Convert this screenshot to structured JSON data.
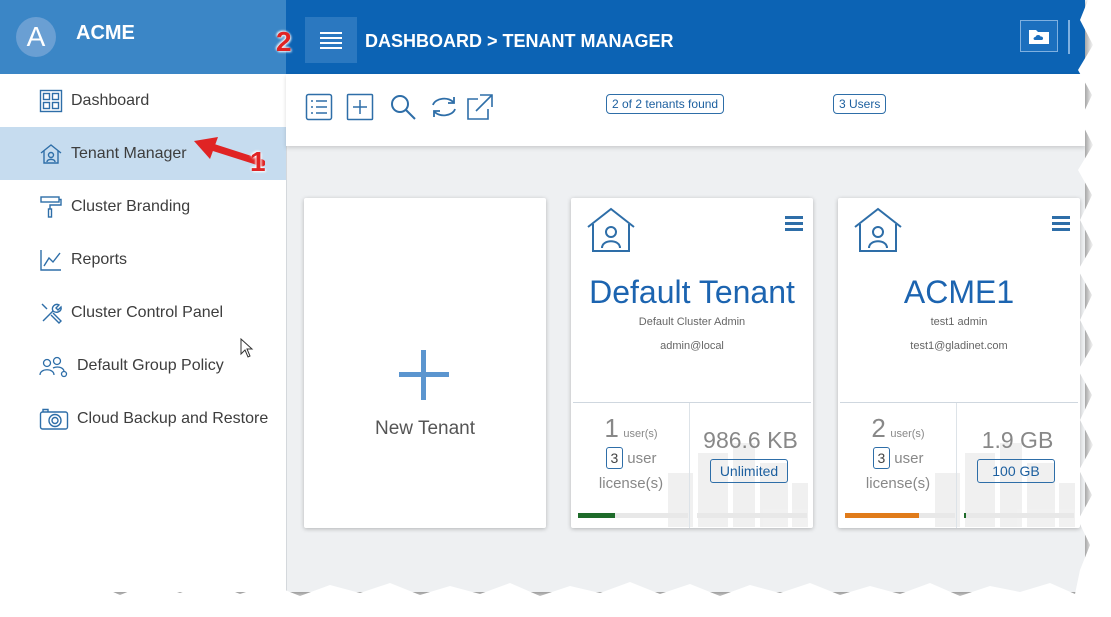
{
  "app": {
    "logo_letter": "A",
    "name": "ACME"
  },
  "header": {
    "breadcrumb": "DASHBOARD > TENANT MANAGER"
  },
  "sidebar": {
    "items": [
      {
        "label": "Dashboard",
        "icon": "dashboard-grid-icon",
        "active": false
      },
      {
        "label": "Tenant Manager",
        "icon": "tenant-house-icon",
        "active": true
      },
      {
        "label": "Cluster Branding",
        "icon": "paint-roller-icon",
        "active": false
      },
      {
        "label": "Reports",
        "icon": "chart-line-icon",
        "active": false
      },
      {
        "label": "Cluster Control Panel",
        "icon": "tools-icon",
        "active": false
      },
      {
        "label": "Default Group Policy",
        "icon": "users-gear-icon",
        "active": false
      },
      {
        "label": "Cloud Backup and Restore",
        "icon": "camera-icon",
        "active": false
      }
    ]
  },
  "toolbar": {
    "tenants_found": "2 of 2 tenants found",
    "users_count": "3 Users"
  },
  "new_tenant": {
    "label": "New Tenant"
  },
  "tenants": [
    {
      "name": "Default Tenant",
      "admin": "Default Cluster Admin",
      "email": "admin@local",
      "users": "1",
      "users_label": "user(s)",
      "licenses": "3",
      "license_label_1": "user",
      "license_label_2": "license(s)",
      "storage": "986.6 KB",
      "quota": "Unlimited",
      "user_bar_pct": 34,
      "storage_bar_pct": 0,
      "user_bar_color": "#1e6b2a",
      "storage_bar_color": "#1e6b2a"
    },
    {
      "name": "ACME1",
      "admin": "test1 admin",
      "email": "test1@gladinet.com",
      "users": "2",
      "users_label": "user(s)",
      "licenses": "3",
      "license_label_1": "user",
      "license_label_2": "license(s)",
      "storage": "1.9 GB",
      "quota": "100 GB",
      "user_bar_pct": 67,
      "storage_bar_pct": 2,
      "user_bar_color": "#e07b1a",
      "storage_bar_color": "#1e6b2a"
    }
  ],
  "annotations": {
    "one": "1",
    "two": "2"
  },
  "colors": {
    "header": "#0c63b4",
    "brand": "#3b86c6",
    "accent": "#1c64b0",
    "annotation": "#e02424"
  }
}
